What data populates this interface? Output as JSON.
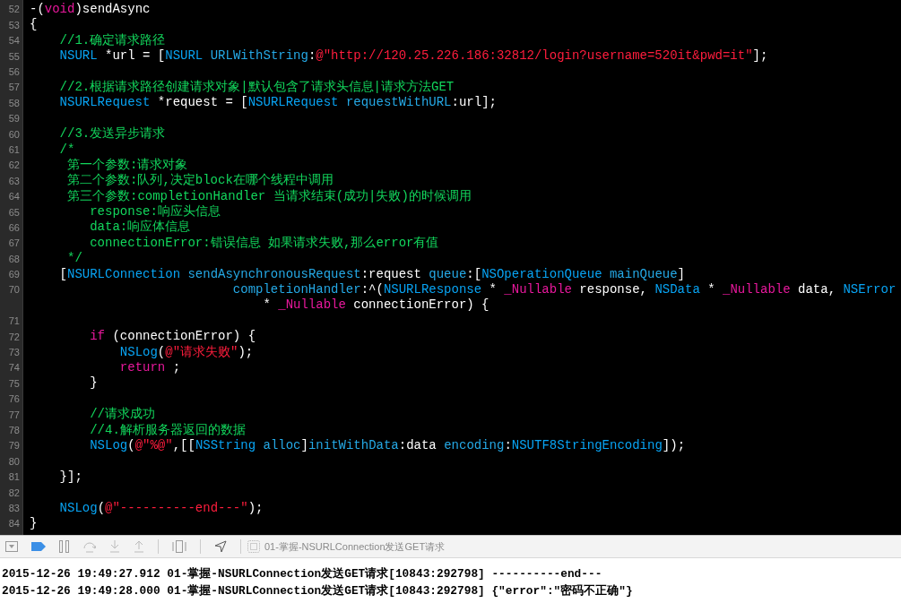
{
  "editor": {
    "lines": [
      {
        "number": "52",
        "tokens": [
          {
            "kind": "plain",
            "text": "-("
          },
          {
            "kind": "keyword",
            "text": "void"
          },
          {
            "kind": "plain",
            "text": ")sendAsync"
          }
        ]
      },
      {
        "number": "53",
        "tokens": [
          {
            "kind": "plain",
            "text": "{"
          }
        ]
      },
      {
        "number": "54",
        "tokens": [
          {
            "kind": "comment",
            "text": "    //1.确定请求路径"
          }
        ]
      },
      {
        "number": "55",
        "tokens": [
          {
            "kind": "type",
            "text": "    NSURL"
          },
          {
            "kind": "plain",
            "text": " *url = ["
          },
          {
            "kind": "type",
            "text": "NSURL"
          },
          {
            "kind": "method",
            "text": " URLWithString"
          },
          {
            "kind": "plain",
            "text": ":"
          },
          {
            "kind": "string",
            "text": "@\"http://120.25.226.186:32812/login?username=520it&pwd=it\""
          },
          {
            "kind": "plain",
            "text": "];"
          }
        ]
      },
      {
        "number": "56"
      },
      {
        "number": "57",
        "tokens": [
          {
            "kind": "comment",
            "text": "    //2.根据请求路径创建请求对象|默认包含了请求头信息|请求方法GET"
          }
        ]
      },
      {
        "number": "58",
        "tokens": [
          {
            "kind": "type",
            "text": "    NSURLRequest"
          },
          {
            "kind": "plain",
            "text": " *request = ["
          },
          {
            "kind": "type",
            "text": "NSURLRequest"
          },
          {
            "kind": "method",
            "text": " requestWithURL"
          },
          {
            "kind": "plain",
            "text": ":url];"
          }
        ]
      },
      {
        "number": "59"
      },
      {
        "number": "60",
        "tokens": [
          {
            "kind": "comment",
            "text": "    //3.发送异步请求"
          }
        ]
      },
      {
        "number": "61",
        "tokens": [
          {
            "kind": "comment",
            "text": "    /*"
          }
        ]
      },
      {
        "number": "62",
        "tokens": [
          {
            "kind": "comment",
            "text": "     第一个参数:请求对象"
          }
        ]
      },
      {
        "number": "63",
        "tokens": [
          {
            "kind": "comment",
            "text": "     第二个参数:队列,决定block在哪个线程中调用"
          }
        ]
      },
      {
        "number": "64",
        "tokens": [
          {
            "kind": "comment",
            "text": "     第三个参数:completionHandler 当请求结束(成功|失败)的时候调用"
          }
        ]
      },
      {
        "number": "65",
        "tokens": [
          {
            "kind": "comment",
            "text": "        response:响应头信息"
          }
        ]
      },
      {
        "number": "66",
        "tokens": [
          {
            "kind": "comment",
            "text": "        data:响应体信息"
          }
        ]
      },
      {
        "number": "67",
        "tokens": [
          {
            "kind": "comment",
            "text": "        connectionError:错误信息 如果请求失败,那么error有值"
          }
        ]
      },
      {
        "number": "68",
        "tokens": [
          {
            "kind": "comment",
            "text": "     */"
          }
        ]
      },
      {
        "number": "69",
        "tokens": [
          {
            "kind": "plain",
            "text": "    ["
          },
          {
            "kind": "type",
            "text": "NSURLConnection"
          },
          {
            "kind": "method",
            "text": " sendAsynchronousRequest"
          },
          {
            "kind": "plain",
            "text": ":request"
          },
          {
            "kind": "method",
            "text": " queue"
          },
          {
            "kind": "plain",
            "text": ":["
          },
          {
            "kind": "type",
            "text": "NSOperationQueue"
          },
          {
            "kind": "method",
            "text": " mainQueue"
          },
          {
            "kind": "plain",
            "text": "]"
          }
        ]
      },
      {
        "number": "70",
        "tokens": [
          {
            "kind": "method",
            "text": "                           completionHandler"
          },
          {
            "kind": "plain",
            "text": ":^("
          },
          {
            "kind": "type",
            "text": "NSURLResponse"
          },
          {
            "kind": "plain",
            "text": " * "
          },
          {
            "kind": "keyword",
            "text": "_Nullable"
          },
          {
            "kind": "plain",
            "text": " response, "
          },
          {
            "kind": "type",
            "text": "NSData"
          },
          {
            "kind": "plain",
            "text": " * "
          },
          {
            "kind": "keyword",
            "text": "_Nullable"
          },
          {
            "kind": "plain",
            "text": " data, "
          },
          {
            "kind": "type",
            "text": "NSError"
          }
        ],
        "wrap_tokens": [
          {
            "kind": "plain",
            "text": "                               * "
          },
          {
            "kind": "keyword",
            "text": "_Nullable"
          },
          {
            "kind": "plain",
            "text": " connectionError) {"
          }
        ]
      },
      {
        "number": "71"
      },
      {
        "number": "72",
        "tokens": [
          {
            "kind": "keyword",
            "text": "        if"
          },
          {
            "kind": "plain",
            "text": " (connectionError) {"
          }
        ]
      },
      {
        "number": "73",
        "tokens": [
          {
            "kind": "type",
            "text": "            NSLog"
          },
          {
            "kind": "plain",
            "text": "("
          },
          {
            "kind": "string",
            "text": "@\"请求失败\""
          },
          {
            "kind": "plain",
            "text": ");"
          }
        ]
      },
      {
        "number": "74",
        "tokens": [
          {
            "kind": "keyword",
            "text": "            return"
          },
          {
            "kind": "plain",
            "text": " ;"
          }
        ]
      },
      {
        "number": "75",
        "tokens": [
          {
            "kind": "plain",
            "text": "        }"
          }
        ]
      },
      {
        "number": "76"
      },
      {
        "number": "77",
        "tokens": [
          {
            "kind": "comment",
            "text": "        //请求成功"
          }
        ]
      },
      {
        "number": "78",
        "tokens": [
          {
            "kind": "comment",
            "text": "        //4.解析服务器返回的数据"
          }
        ]
      },
      {
        "number": "79",
        "tokens": [
          {
            "kind": "type",
            "text": "        NSLog"
          },
          {
            "kind": "plain",
            "text": "("
          },
          {
            "kind": "string",
            "text": "@\"%@\""
          },
          {
            "kind": "plain",
            "text": ",[["
          },
          {
            "kind": "type",
            "text": "NSString"
          },
          {
            "kind": "method",
            "text": " alloc"
          },
          {
            "kind": "plain",
            "text": "]"
          },
          {
            "kind": "method",
            "text": "initWithData"
          },
          {
            "kind": "plain",
            "text": ":data"
          },
          {
            "kind": "method",
            "text": " encoding"
          },
          {
            "kind": "plain",
            "text": ":"
          },
          {
            "kind": "type",
            "text": "NSUTF8StringEncoding"
          },
          {
            "kind": "plain",
            "text": "]);"
          }
        ]
      },
      {
        "number": "80"
      },
      {
        "number": "81",
        "tokens": [
          {
            "kind": "plain",
            "text": "    }];"
          }
        ]
      },
      {
        "number": "82"
      },
      {
        "number": "83",
        "tokens": [
          {
            "kind": "type",
            "text": "    NSLog"
          },
          {
            "kind": "plain",
            "text": "("
          },
          {
            "kind": "string",
            "text": "@\"----------end---\""
          },
          {
            "kind": "plain",
            "text": ");"
          }
        ]
      },
      {
        "number": "84",
        "tokens": [
          {
            "kind": "plain",
            "text": "}"
          }
        ]
      }
    ]
  },
  "debug_bar": {
    "process_title": "01-掌握-NSURLConnection发送GET请求"
  },
  "console": {
    "lines": [
      "2015-12-26 19:49:27.912 01-掌握-NSURLConnection发送GET请求[10843:292798] ----------end---",
      "2015-12-26 19:49:28.000 01-掌握-NSURLConnection发送GET请求[10843:292798] {\"error\":\"密码不正确\"}"
    ]
  }
}
